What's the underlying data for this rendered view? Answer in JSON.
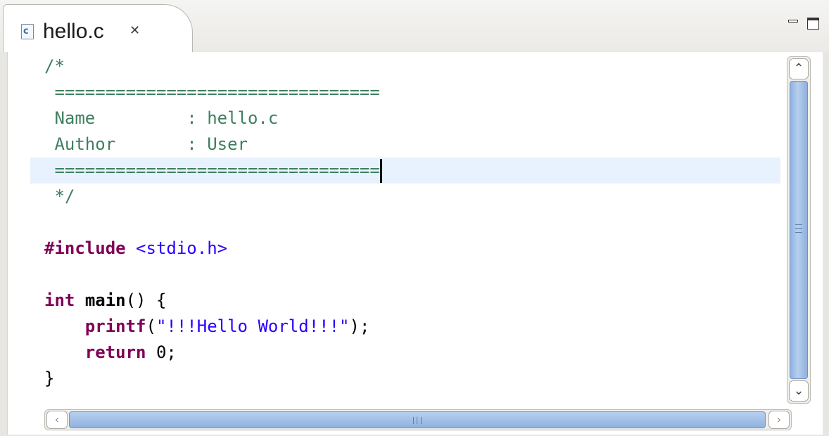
{
  "tab": {
    "file_icon_letter": "c",
    "title": "hello.c",
    "close_glyph": "✕"
  },
  "view_controls": {
    "minimize_icon": "minimize-icon",
    "maximize_icon": "maximize-icon"
  },
  "editor": {
    "lines": [
      {
        "tokens": [
          {
            "t": "/*",
            "c": "cmt"
          }
        ]
      },
      {
        "tokens": [
          {
            "t": " ================================",
            "c": "cmt"
          }
        ]
      },
      {
        "tokens": [
          {
            "t": " Name         : hello.c",
            "c": "cmt"
          }
        ]
      },
      {
        "tokens": [
          {
            "t": " Author       : User",
            "c": "cmt"
          }
        ]
      },
      {
        "tokens": [
          {
            "t": " ================================",
            "c": "cmt"
          }
        ],
        "current": true
      },
      {
        "tokens": [
          {
            "t": " */",
            "c": "cmt"
          }
        ]
      },
      {
        "tokens": []
      },
      {
        "tokens": [
          {
            "t": "#include",
            "c": "kw"
          },
          {
            "t": " ",
            "c": ""
          },
          {
            "t": "<stdio.h>",
            "c": "str"
          }
        ]
      },
      {
        "tokens": []
      },
      {
        "tokens": [
          {
            "t": "int",
            "c": "kw"
          },
          {
            "t": " ",
            "c": ""
          },
          {
            "t": "main",
            "c": "fn"
          },
          {
            "t": "() {",
            "c": ""
          }
        ]
      },
      {
        "tokens": [
          {
            "t": "    ",
            "c": ""
          },
          {
            "t": "printf",
            "c": "kw"
          },
          {
            "t": "(",
            "c": ""
          },
          {
            "t": "\"!!!Hello World!!!\"",
            "c": "str"
          },
          {
            "t": ");",
            "c": ""
          }
        ]
      },
      {
        "tokens": [
          {
            "t": "    ",
            "c": ""
          },
          {
            "t": "return",
            "c": "kw"
          },
          {
            "t": " 0;",
            "c": ""
          }
        ]
      },
      {
        "tokens": [
          {
            "t": "}",
            "c": ""
          }
        ]
      }
    ]
  },
  "scrollbars": {
    "vertical_grip": "≡",
    "horizontal_grip": "III",
    "up_arrow": "⌃",
    "down_arrow": "⌄",
    "left_arrow": "‹",
    "right_arrow": "›"
  },
  "colors": {
    "comment": "#3f7f5f",
    "keyword": "#7f0055",
    "string": "#2a00ff",
    "current_line": "#e8f2fe",
    "scroll_thumb": "#8fb2e0"
  }
}
